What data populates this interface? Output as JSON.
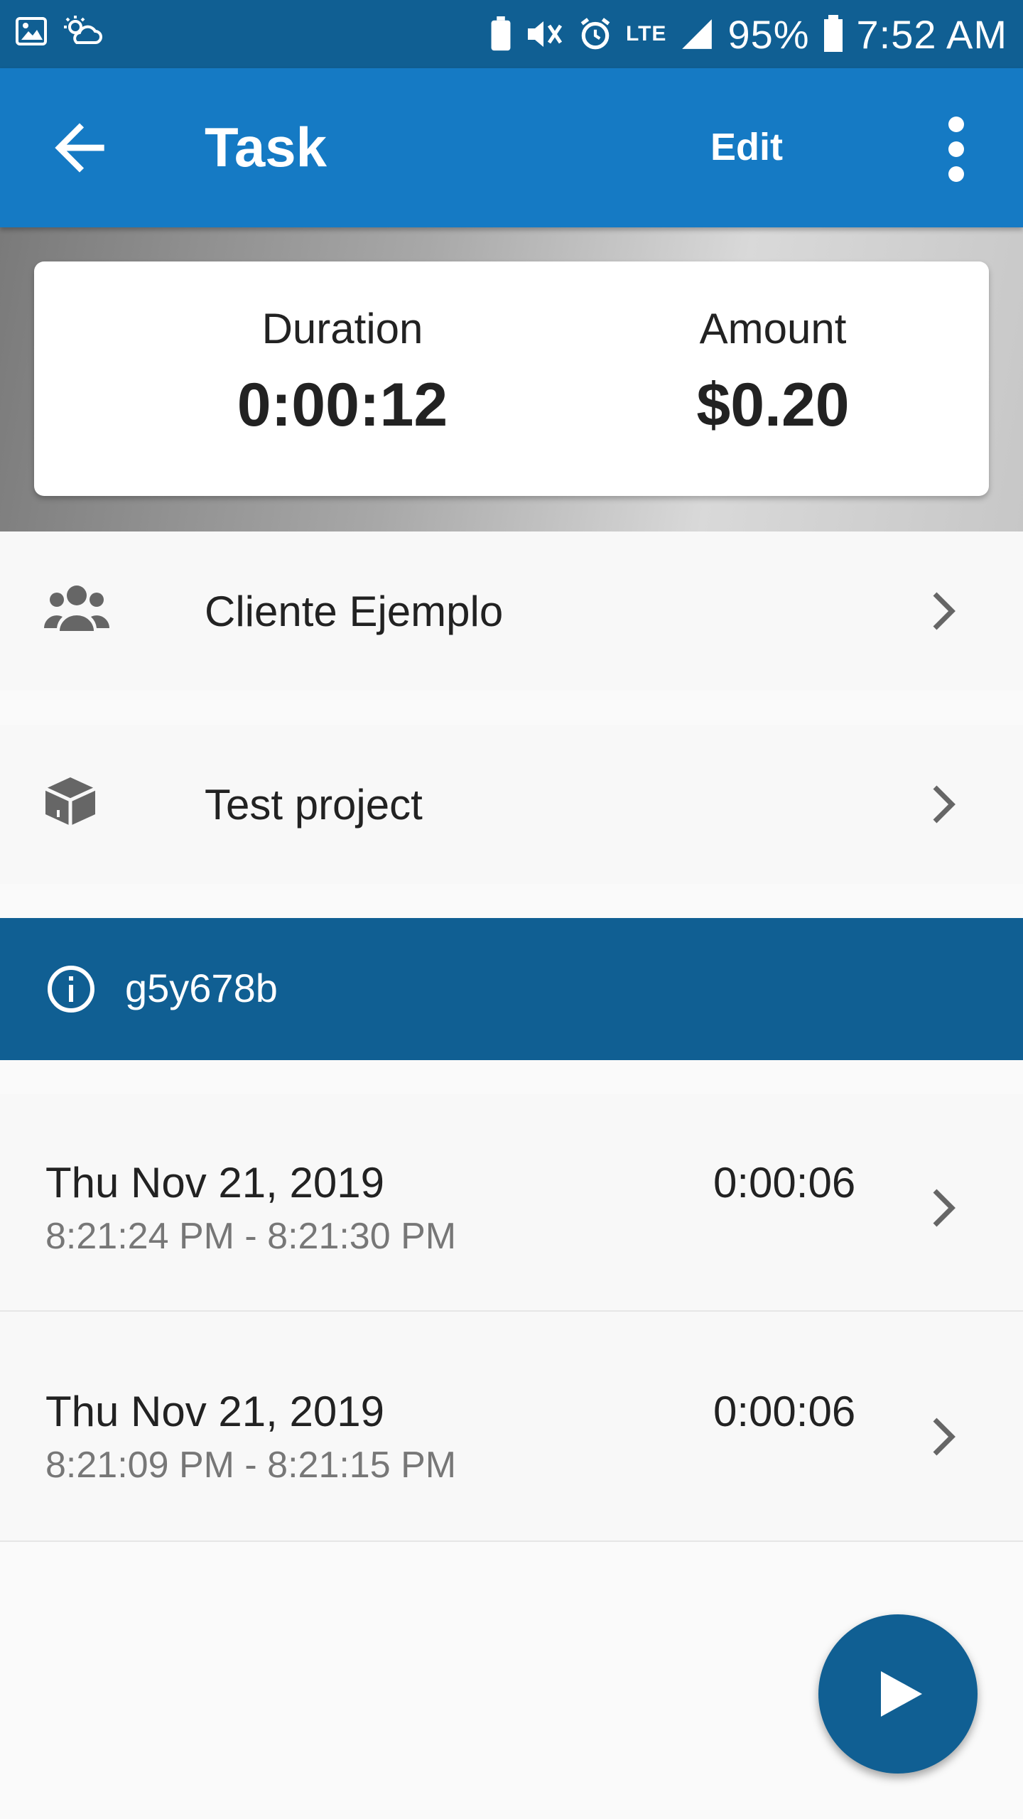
{
  "status_bar": {
    "battery": "95%",
    "time": "7:52 AM",
    "network": "LTE"
  },
  "app_bar": {
    "title": "Task",
    "edit_label": "Edit"
  },
  "summary": {
    "duration_label": "Duration",
    "duration_value": "0:00:12",
    "amount_label": "Amount",
    "amount_value": "$0.20"
  },
  "client": {
    "label": "Cliente Ejemplo",
    "icon": "users-icon"
  },
  "project": {
    "label": "Test project",
    "icon": "box-icon"
  },
  "info": {
    "text": "g5y678b",
    "icon": "info-icon"
  },
  "entries": [
    {
      "date": "Thu Nov 21, 2019",
      "time_range": "8:21:24 PM - 8:21:30 PM",
      "duration": "0:00:06"
    },
    {
      "date": "Thu Nov 21, 2019",
      "time_range": "8:21:09 PM - 8:21:15 PM",
      "duration": "0:00:06"
    }
  ],
  "colors": {
    "primary": "#157ac4",
    "primary_dark": "#105f93"
  }
}
